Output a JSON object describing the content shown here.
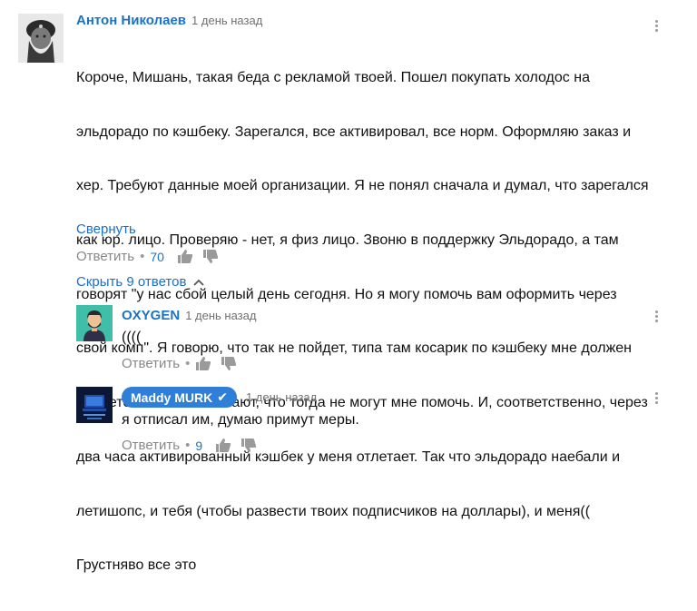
{
  "comment": {
    "author": "Антон Николаев",
    "time": "1 день назад",
    "lines": [
      "Короче, Мишань, такая беда с рекламой твоей. Пошел покупать холодос на",
      "эльдорадо по кэшбеку. Зарегался, все активировал, все норм. Оформляю заказ и",
      "хер. Требуют данные моей организации. Я не понял сначала и думал, что зарегался",
      "как юр. лицо. Проверяю - нет, я физ лицо. Звоню в поддержку Эльдорадо, а там",
      "говорят \"у нас сбой целый день сегодня. Но я могу помочь вам оформить через",
      "свой комп\". Я говорю, что так не пойдет, типа там косарик по кэшбеку мне должен",
      "прилететь. А они отвечают, что тогда не могут мне помочь. И, соответственно, через",
      "два часа активированный кэшбек у меня отлетает. Так что эльдорадо наебали и",
      "летишопс, и тебя (чтобы развести твоих подписчиков на доллары), и меня((",
      "Грустняво все это"
    ],
    "collapse_label": "Свернуть",
    "reply_label": "Ответить",
    "likes": "70",
    "hide_replies_label": "Скрыть 9 ответов"
  },
  "replies": [
    {
      "author": "OXYGEN",
      "time": "1 день назад",
      "text": "((((",
      "reply_label": "Ответить",
      "likes": ""
    },
    {
      "author": "Maddy MURK",
      "verified_check": "✔",
      "time": "1 день назад",
      "text": "я отписал им, думаю примут меры.",
      "reply_label": "Ответить",
      "likes": "9"
    }
  ],
  "colors": {
    "link": "#1a73c8",
    "badge": "#2f7ed8",
    "muted": "#888888"
  }
}
